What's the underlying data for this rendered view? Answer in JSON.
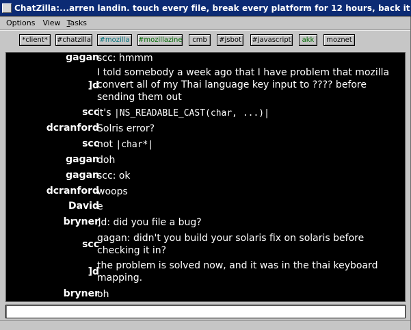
{
  "window": {
    "title": "ChatZilla:...arren landin. touch every file, break every platform for 12 hours, back it all out"
  },
  "menu": [
    {
      "label": "Options"
    },
    {
      "label": "View"
    },
    {
      "label": "Tasks",
      "mnemonic": "T",
      "rest": "asks"
    }
  ],
  "tabs": [
    {
      "label": "*client*",
      "color": "#000000"
    },
    {
      "label": "#chatzilla",
      "color": "#000000"
    },
    {
      "label": "#mozilla",
      "color": "#00707a"
    },
    {
      "label": "#mozillazine",
      "color": "#006a00"
    },
    {
      "label": "cmb",
      "color": "#000000"
    },
    {
      "label": "#jsbot",
      "color": "#000000"
    },
    {
      "label": "#javascript",
      "color": "#000000"
    },
    {
      "label": "akk",
      "color": "#006a00"
    },
    {
      "label": "moznet",
      "color": "#000000"
    }
  ],
  "messages": [
    {
      "nick": "gagan",
      "text": "scc: hmmm"
    },
    {
      "nick": "]d",
      "text": "I told somebody a week ago that I have problem that mozilla convert all of my Thai language key input to ???? before sending them out"
    },
    {
      "nick": "scc",
      "text_pre": "it's ",
      "code": "|NS_READABLE_CAST(char, ...)|"
    },
    {
      "nick": "dcranford",
      "text": "Solris error?"
    },
    {
      "nick": "scc",
      "text_pre": "not ",
      "code": "|char*|"
    },
    {
      "nick": "gagan",
      "text": "doh"
    },
    {
      "nick": "gagan",
      "text": "scc: ok"
    },
    {
      "nick": "dcranford",
      "text": "woops"
    },
    {
      "nick": "David",
      "text": "e"
    },
    {
      "nick": "bryner",
      "text": "]d: did you file a bug?"
    },
    {
      "nick": "scc",
      "text": "gagan: didn't you build your solaris fix on solaris before checking it in?"
    },
    {
      "nick": "]d",
      "text": "the problem is solved now, and it was in the thai keyboard mapping."
    },
    {
      "nick": "bryner",
      "text": "oh"
    }
  ],
  "input": {
    "value": ""
  },
  "colors": {
    "titlebar": "#0c2b74",
    "chat_bg": "#000000",
    "chat_text": "#ffffff",
    "chrome": "#c6c6c6"
  }
}
